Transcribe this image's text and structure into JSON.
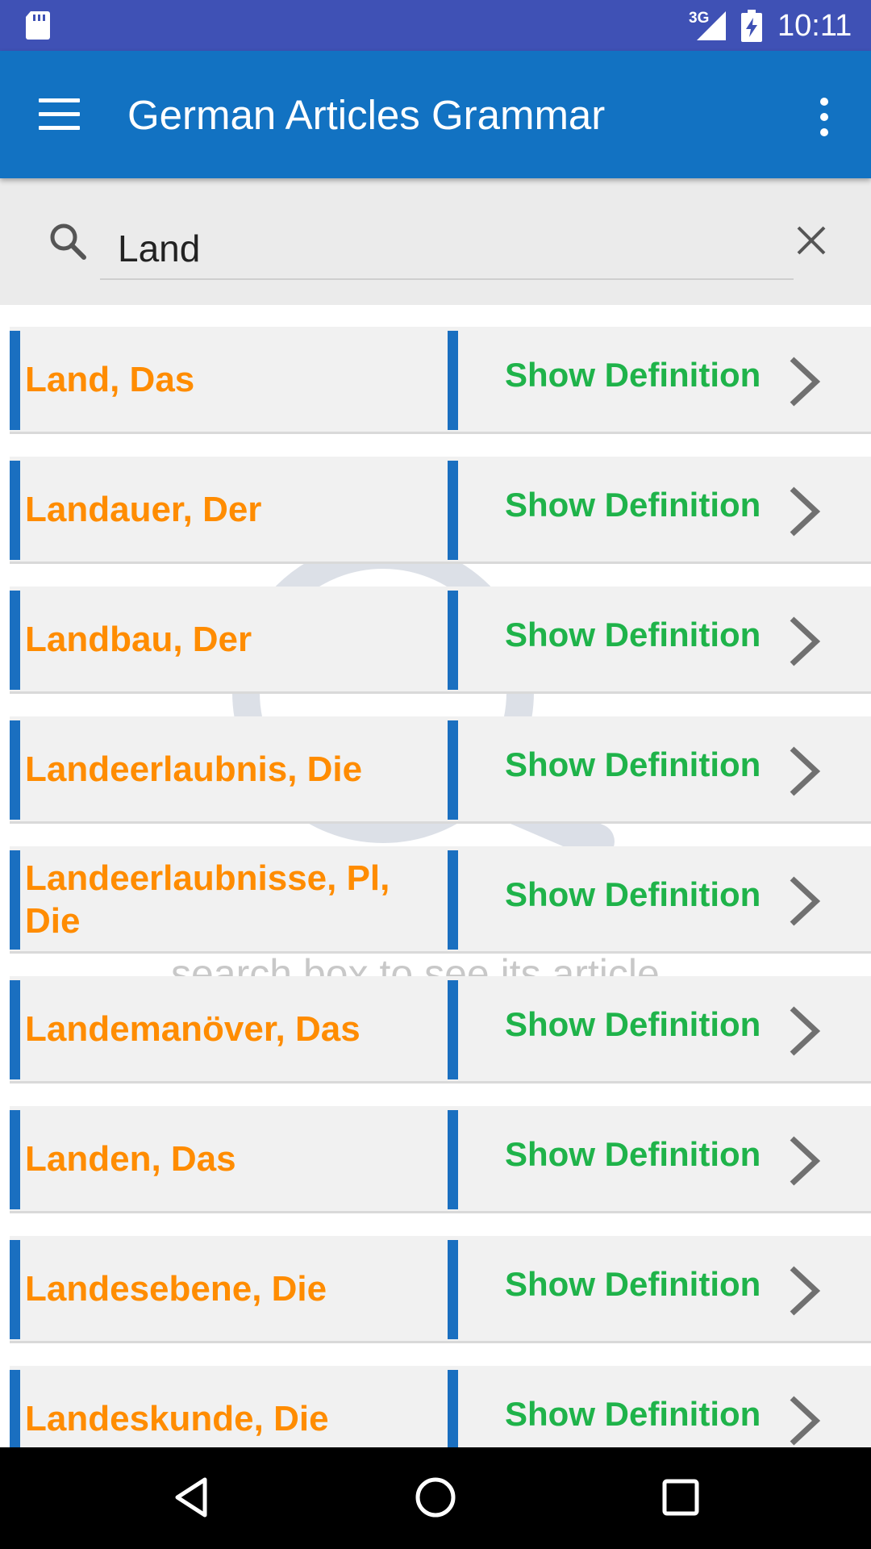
{
  "status_bar": {
    "network_type": "3G",
    "time": "10:11",
    "icons": [
      "sd-card-icon",
      "signal-icon",
      "battery-charging-icon"
    ]
  },
  "app_bar": {
    "title": "German Articles Grammar",
    "icons": [
      "menu-icon",
      "overflow-menu-icon"
    ]
  },
  "search": {
    "value": "Land",
    "icons": [
      "search-icon",
      "clear-icon"
    ]
  },
  "background_hint": "search box to see its article",
  "results": [
    {
      "word": "Land, Das",
      "action": "Show Definition"
    },
    {
      "word": "Landauer, Der",
      "action": "Show Definition"
    },
    {
      "word": "Landbau, Der",
      "action": "Show Definition"
    },
    {
      "word": "Landeerlaubnis, Die",
      "action": "Show Definition"
    },
    {
      "word": "Landeerlaubnisse, Pl, Die",
      "action": "Show Definition"
    },
    {
      "word": "Landemanöver, Das",
      "action": "Show Definition"
    },
    {
      "word": "Landen, Das",
      "action": "Show Definition"
    },
    {
      "word": "Landesebene, Die",
      "action": "Show Definition"
    },
    {
      "word": "Landeskunde, Die",
      "action": "Show Definition"
    }
  ],
  "colors": {
    "status_bar": "#3f51b5",
    "app_bar": "#1272c2",
    "accent_bar": "#1a6fc0",
    "word_text": "#ff8c00",
    "action_text": "#1fb34a"
  },
  "nav_bar": {
    "icons": [
      "back-icon",
      "home-icon",
      "recent-apps-icon"
    ]
  }
}
